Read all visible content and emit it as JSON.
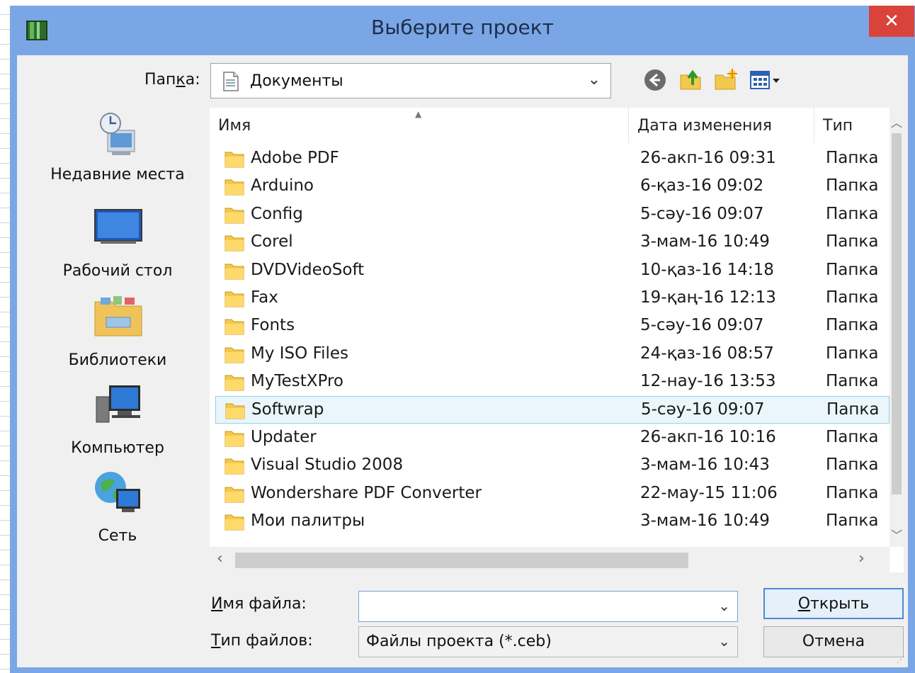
{
  "window": {
    "title": "Выберите проект",
    "close_label": "✕"
  },
  "lookin": {
    "label_pre": "Пап",
    "label_accel": "к",
    "label_post": "а:",
    "value": "Документы"
  },
  "places": [
    {
      "label": "Недавние места",
      "icon": "recent-places-icon"
    },
    {
      "label": "Рабочий стол",
      "icon": "desktop-icon"
    },
    {
      "label": "Библиотеки",
      "icon": "libraries-icon"
    },
    {
      "label": "Компьютер",
      "icon": "computer-icon"
    },
    {
      "label": "Сеть",
      "icon": "network-icon"
    }
  ],
  "columns": {
    "name": "Имя",
    "date": "Дата изменения",
    "type": "Тип"
  },
  "files": [
    {
      "name": "Adobe PDF",
      "date": "26-акп-16 09:31",
      "type": "Папка"
    },
    {
      "name": "Arduino",
      "date": "6-қаз-16 09:02",
      "type": "Папка"
    },
    {
      "name": "Config",
      "date": "5-сәу-16 09:07",
      "type": "Папка"
    },
    {
      "name": "Corel",
      "date": "3-мам-16 10:49",
      "type": "Папка"
    },
    {
      "name": "DVDVideoSoft",
      "date": "10-қаз-16 14:18",
      "type": "Папка"
    },
    {
      "name": "Fax",
      "date": "19-қаң-16 12:13",
      "type": "Папка"
    },
    {
      "name": "Fonts",
      "date": "5-сәу-16 09:07",
      "type": "Папка"
    },
    {
      "name": "My ISO Files",
      "date": "24-қаз-16 08:57",
      "type": "Папка"
    },
    {
      "name": "MyTestXPro",
      "date": "12-нау-16 13:53",
      "type": "Папка"
    },
    {
      "name": "Softwrap",
      "date": "5-сәу-16 09:07",
      "type": "Папка"
    },
    {
      "name": "Updater",
      "date": "26-акп-16 10:16",
      "type": "Папка"
    },
    {
      "name": "Visual Studio 2008",
      "date": "3-мам-16 10:43",
      "type": "Папка"
    },
    {
      "name": "Wondershare PDF Converter",
      "date": "22-мау-15 11:06",
      "type": "Папка"
    },
    {
      "name": "Мои палитры",
      "date": "3-мам-16 10:49",
      "type": "Папка"
    }
  ],
  "selected_file": "Softwrap",
  "filename": {
    "label_accel": "И",
    "label_post": "мя файла:",
    "value": ""
  },
  "filetype": {
    "label_accel": "Т",
    "label_post": "ип файлов:",
    "value": "Файлы проекта (*.ceb)"
  },
  "buttons": {
    "open_accel": "О",
    "open_post": "ткрыть",
    "cancel": "Отмена"
  },
  "colors": {
    "window_frame": "#7aa6e6",
    "close_button": "#d9433a",
    "selection_bg": "#eaf6fb",
    "selection_border": "#8fd3ea"
  }
}
